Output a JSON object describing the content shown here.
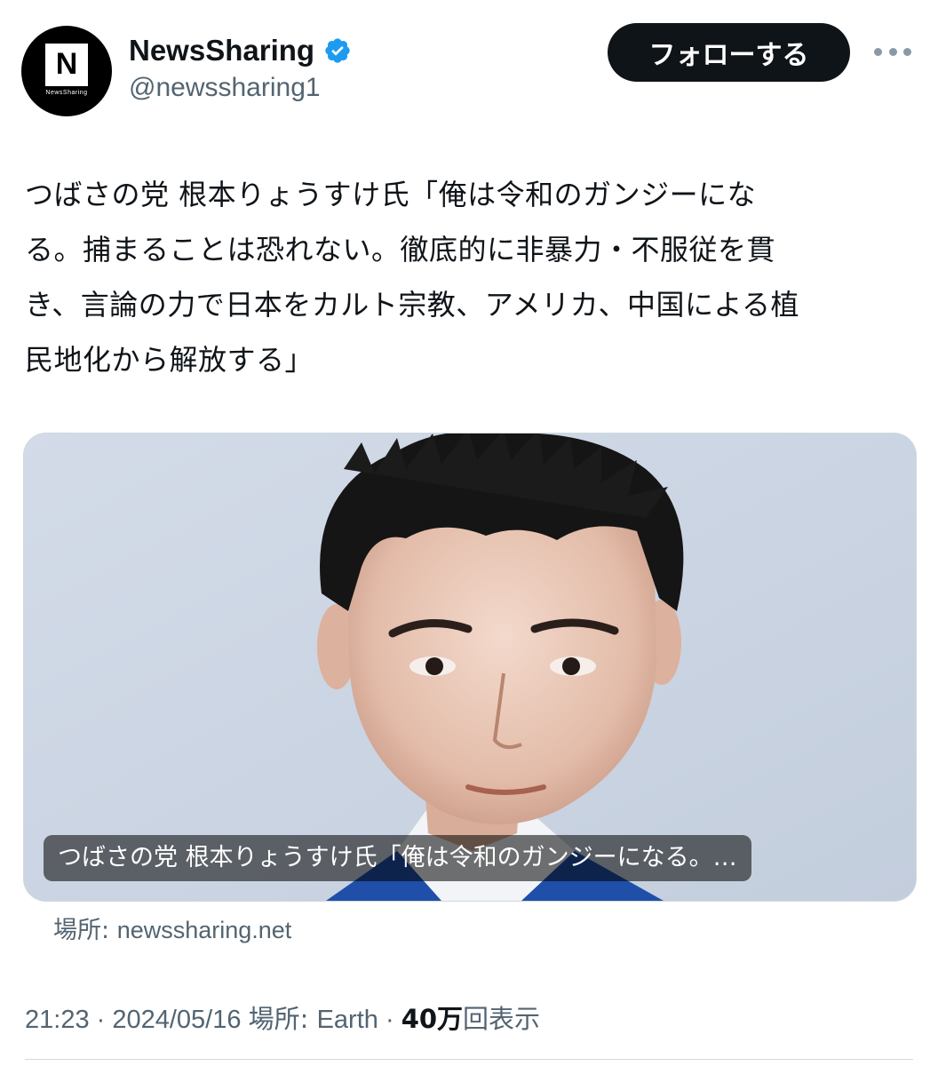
{
  "author": {
    "display_name": "NewsSharing",
    "handle": "@newssharing1",
    "avatar_letter": "N",
    "avatar_caption": "NewsSharing",
    "verified": true
  },
  "actions": {
    "follow_label": "フォローする",
    "more_icon": "more-horizontal-icon"
  },
  "tweet": {
    "text_lines": [
      "つばさの党 根本りょうすけ氏「俺は令和のガンジーにな",
      "る。捕まることは恐れない。徹底的に非暴力・不服従を貫",
      "き、言論の力で日本をカルト宗教、アメリカ、中国による植",
      "民地化から解放する」"
    ]
  },
  "card": {
    "title": "つばさの党 根本りょうすけ氏「俺は令和のガンジーになる。…",
    "source_prefix": "場所: ",
    "source_domain": "newssharing.net"
  },
  "meta": {
    "time": "21:23",
    "separator": " · ",
    "date": "2024/05/16",
    "location_prefix": "場所: ",
    "location": "Earth",
    "views_count": "40万",
    "views_label": "回表示"
  },
  "colors": {
    "text_primary": "#0f1419",
    "text_secondary": "#536471",
    "verified_blue": "#1d9bf0",
    "follow_bg": "#0f1419"
  }
}
